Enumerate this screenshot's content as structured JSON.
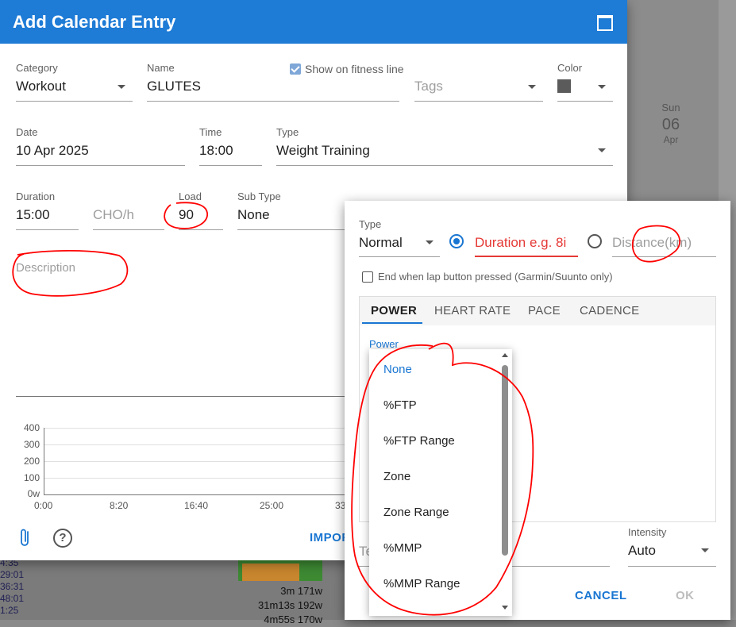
{
  "background": {
    "sun_label": "Sun",
    "sun_day": "06",
    "sun_month": "Apr",
    "left_times": [
      "4:35",
      "29:01",
      "36:31",
      "48:01",
      "1:25"
    ],
    "block_stats": [
      "3m 171w",
      "31m13s 192w",
      "4m55s 170w"
    ]
  },
  "dialog": {
    "title": "Add Calendar Entry",
    "category": {
      "label": "Category",
      "value": "Workout"
    },
    "name": {
      "label": "Name",
      "value": "GLUTES"
    },
    "show_fitness": "Show on fitness line",
    "tags": {
      "placeholder": "Tags"
    },
    "color": {
      "label": "Color",
      "value": "#5b5b5b"
    },
    "date": {
      "label": "Date",
      "value": "10 Apr 2025"
    },
    "time": {
      "label": "Time",
      "value": "18:00"
    },
    "type": {
      "label": "Type",
      "value": "Weight Training"
    },
    "duration": {
      "label": "Duration",
      "value": "15:00"
    },
    "cho": {
      "placeholder": "CHO/h"
    },
    "load": {
      "label": "Load",
      "value": "90"
    },
    "subtype": {
      "label": "Sub Type",
      "value": "None"
    },
    "description": {
      "placeholder": "Description"
    },
    "chart": {
      "y_ticks": [
        "400",
        "300",
        "200",
        "100",
        "0w"
      ],
      "x_ticks": [
        "0:00",
        "8:20",
        "16:40",
        "25:00",
        "33"
      ]
    },
    "import_label": "IMPOR"
  },
  "step_dialog": {
    "type": {
      "label": "Type",
      "value": "Normal"
    },
    "duration_placeholder": "Duration e.g. 8i",
    "distance_placeholder": "Distance(km)",
    "end_lap": "End when lap button pressed (Garmin/Suunto only)",
    "tabs": [
      "POWER",
      "HEART RATE",
      "PACE",
      "CADENCE"
    ],
    "power_label": "Power",
    "target_partial": "Te",
    "intensity": {
      "label": "Intensity",
      "value": "Auto"
    },
    "cancel": "CANCEL",
    "ok": "OK"
  },
  "dropdown": {
    "options": [
      "None",
      "%FTP",
      "%FTP Range",
      "Zone",
      "Zone Range",
      "%MMP",
      "%MMP Range"
    ],
    "selected_index": 0
  },
  "colors": {
    "primary": "#1e7bd6",
    "error": "#e53935",
    "annotation": "#ff0000"
  }
}
